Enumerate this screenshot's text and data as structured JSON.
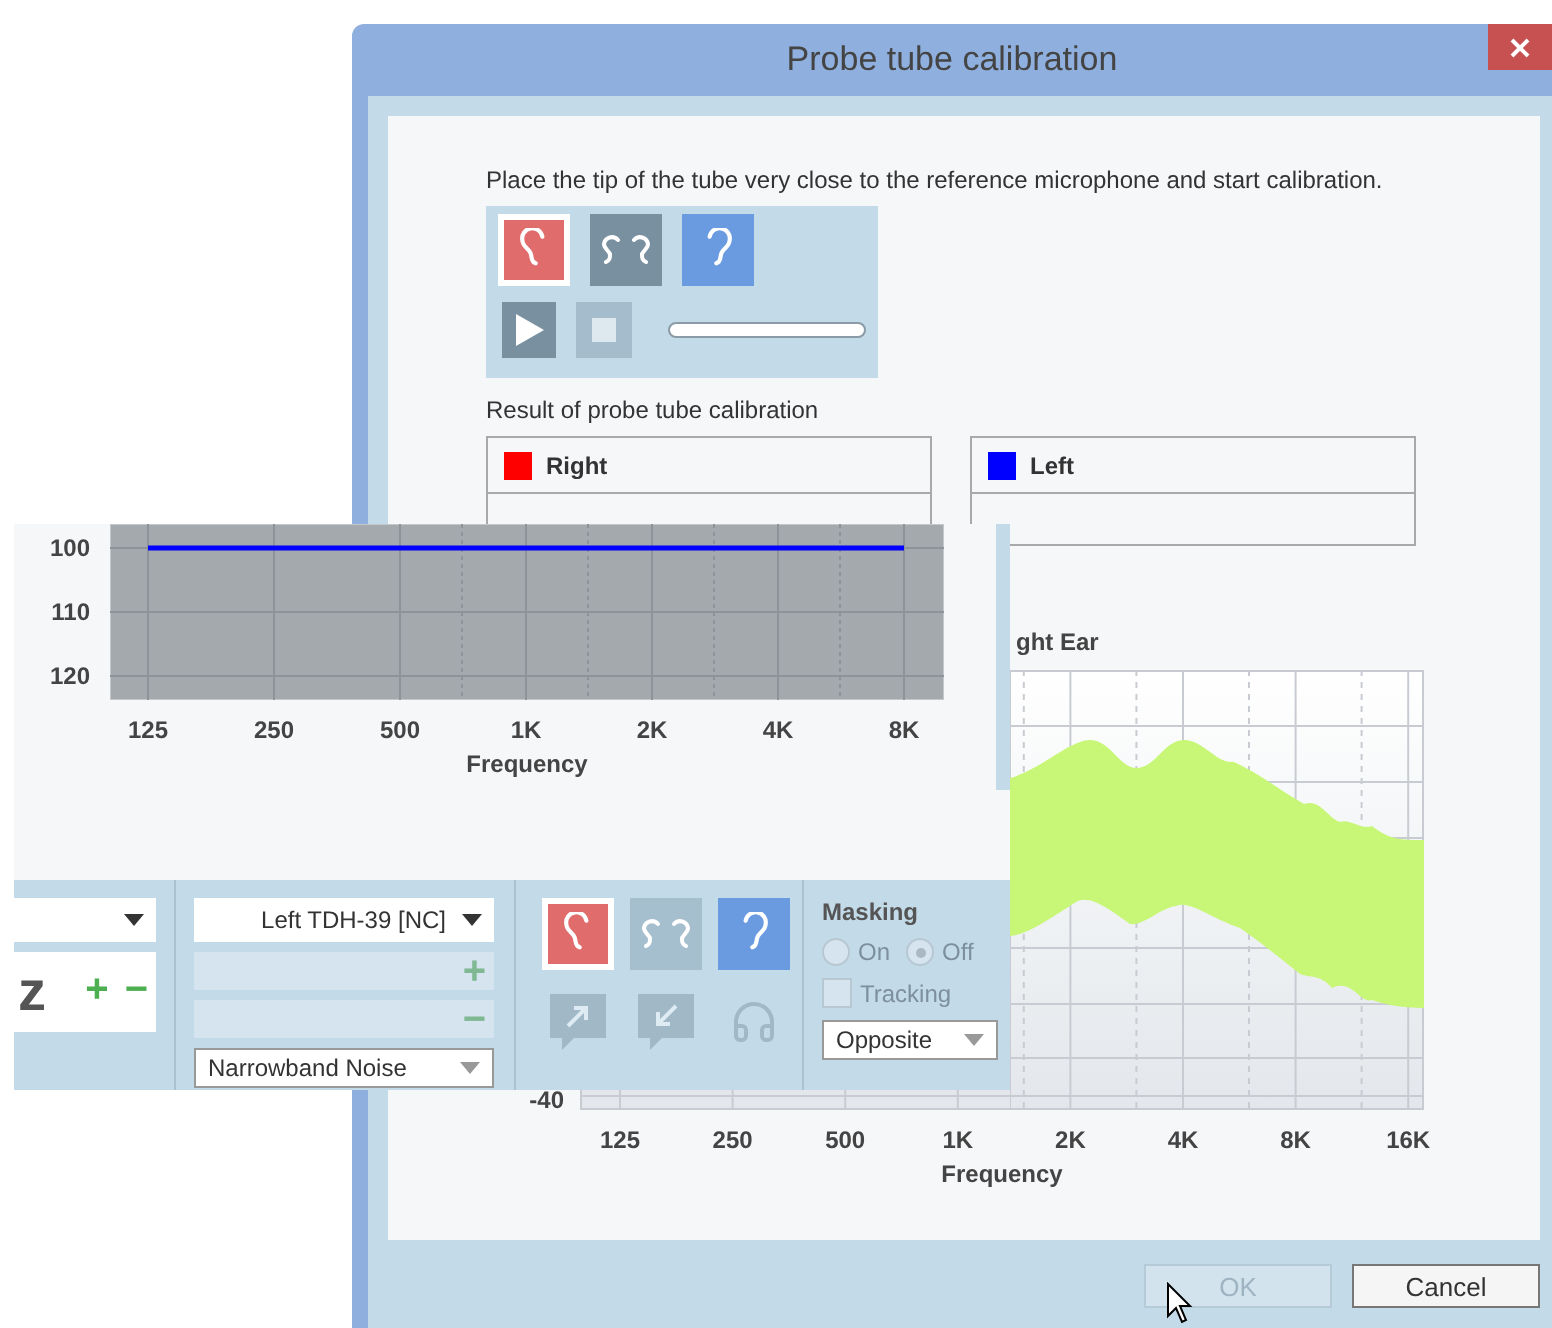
{
  "dialog": {
    "title": "Probe tube calibration",
    "instruction": "Place the tip of the tube very close to the reference microphone and start calibration.",
    "ear_buttons": [
      {
        "kind": "right",
        "selected": true,
        "disabled": false
      },
      {
        "kind": "both",
        "selected": false,
        "disabled": false
      },
      {
        "kind": "left",
        "selected": false,
        "disabled": false
      }
    ],
    "progress": {
      "level": 0
    },
    "transport": [
      {
        "kind": "play",
        "disabled": false
      },
      {
        "kind": "stop",
        "disabled": true
      }
    ],
    "result_label": "Result of probe tube calibration",
    "results": [
      {
        "label": "Right",
        "color": "#ff0000"
      },
      {
        "label": "Left",
        "color": "#0000ff"
      }
    ],
    "chart": {
      "title": "ght Ear",
      "y_tick": "-40",
      "x_ticks": [
        "125",
        "250",
        "500",
        "1K",
        "2K",
        "4K",
        "8K",
        "16K"
      ],
      "xlabel": "Frequency"
    },
    "buttons": [
      {
        "label": "OK",
        "disabled": true
      },
      {
        "label": "Cancel",
        "disabled": false
      }
    ]
  },
  "overlay": {
    "chart_data": {
      "type": "line",
      "xlabel": "Frequency",
      "categories": [
        "125",
        "250",
        "500",
        "1K",
        "2K",
        "4K",
        "8K"
      ],
      "series": [
        {
          "color": "#0000ff",
          "values": [
            100,
            100,
            100,
            100,
            100,
            100,
            100
          ]
        }
      ],
      "grid": true,
      "ylim": [
        123.75,
        96.25
      ],
      "yticks": [
        {
          "value": 100,
          "label": "100"
        },
        {
          "value": 110,
          "label": "110"
        },
        {
          "value": 120,
          "label": "120"
        }
      ]
    },
    "frequency": {
      "unit": "z",
      "step_buttons": [
        "+",
        "−"
      ]
    },
    "output": {
      "value": "Left TDH-39 [NC]",
      "step_buttons": [
        "+",
        "−"
      ],
      "stimulus": "Narrowband Noise"
    },
    "ear_buttons": [
      {
        "kind": "right",
        "selected": true,
        "disabled": false
      },
      {
        "kind": "both",
        "selected": false,
        "disabled": true
      },
      {
        "kind": "left",
        "selected": false,
        "disabled": false
      }
    ],
    "actions": [
      {
        "kind": "send",
        "disabled": true
      },
      {
        "kind": "receive",
        "disabled": true
      },
      {
        "kind": "headphones",
        "disabled": true
      }
    ],
    "masking": {
      "title": "Masking",
      "disabled": true,
      "options": [
        {
          "label": "On",
          "selected": false
        },
        {
          "label": "Off",
          "selected": true
        }
      ],
      "tracking": {
        "label": "Tracking",
        "checked": false
      },
      "mode": "Opposite"
    }
  }
}
